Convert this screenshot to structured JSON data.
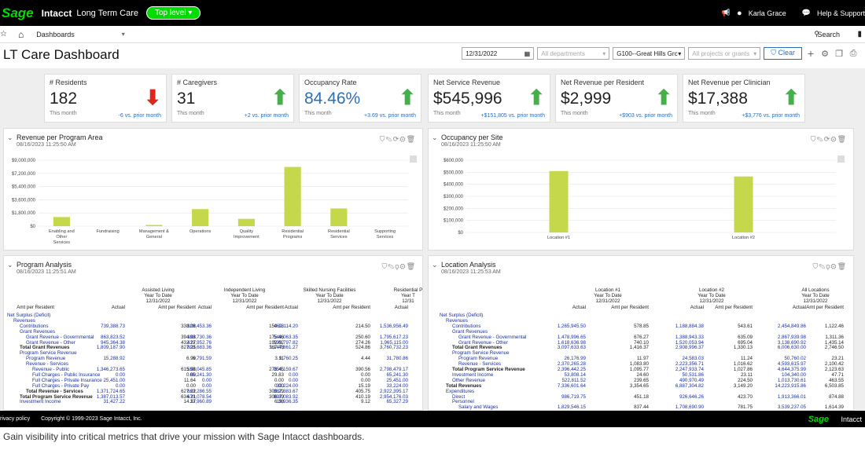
{
  "topbar": {
    "logo": "Sage",
    "product": "Intacct",
    "company": "Long Term Care",
    "level": "Top level",
    "user": "Karla Grace",
    "help": "Help & Support"
  },
  "nav": {
    "menu": "Dashboards",
    "search": "Search"
  },
  "page": {
    "title": "LT Care Dashboard",
    "date": "12/31/2022",
    "departments_ph": "All departments",
    "location": "G100--Great Hills Grc",
    "projects_ph": "All projects or grants",
    "clear": "Clear"
  },
  "kpis": [
    {
      "label": "# Residents",
      "value": "182",
      "sub": "This month",
      "compare": "-6 vs. prior month",
      "trend": "down"
    },
    {
      "label": "# Caregivers",
      "value": "31",
      "sub": "This month",
      "compare": "+2 vs. prior month",
      "trend": "up"
    },
    {
      "label": "Occupancy Rate",
      "value": "84.46%",
      "sub": "This month",
      "compare": "+3.69 vs. prior month",
      "trend": "up"
    },
    {
      "label": "Net Service Revenue",
      "value": "$545,996",
      "sub": "This month",
      "compare": "+$151,805 vs. prior month",
      "trend": "up"
    },
    {
      "label": "Net Revenue per Resident",
      "value": "$2,999",
      "sub": "This month",
      "compare": "+$903 vs. prior month",
      "trend": "up"
    },
    {
      "label": "Net Revenue per Clinician",
      "value": "$17,388",
      "sub": "This month",
      "compare": "+$3,776 vs. prior month",
      "trend": "up"
    }
  ],
  "colors": {
    "up": "#43b048",
    "down": "#e0251b",
    "bar": "#c5d84c",
    "brand": "#00dc00",
    "link": "#2a6ebb"
  },
  "panels": {
    "rev": {
      "title": "Revenue per Program Area",
      "date": "08/16/2023 11:25:50 AM"
    },
    "occ": {
      "title": "Occupancy per Site",
      "date": "08/16/2023 11:25:50 AM"
    },
    "prog": {
      "title": "Program Analysis",
      "date": "08/16/2023 11:25:51 AM"
    },
    "loc": {
      "title": "Location Analysis",
      "date": "08/16/2023 11:25:53 AM"
    }
  },
  "chart_data": [
    {
      "type": "bar",
      "title": "Revenue per Program Area",
      "categories": [
        "Enabling and Other Services",
        "Fundraising",
        "Management & General",
        "Operations",
        "Quality Improvement",
        "Residential Programs",
        "Residential Services",
        "Supporting Services"
      ],
      "values": [
        1500000,
        0,
        200000,
        2800000,
        1200000,
        9700000,
        2900000,
        0
      ],
      "yticks": [
        "$0",
        "$1,800,000",
        "$3,600,000",
        "$5,400,000",
        "$7,200,000",
        "$9,000,000"
      ],
      "ylim": [
        0,
        10800000
      ]
    },
    {
      "type": "bar",
      "title": "Occupancy per Site",
      "categories": [
        "Location #1",
        "Location #2"
      ],
      "values": [
        510000,
        465000
      ],
      "yticks": [
        "$0",
        "$100,000",
        "$200,000",
        "$300,000",
        "$400,000",
        "$500,000",
        "$600,000"
      ],
      "ylim": [
        0,
        600000
      ]
    }
  ],
  "prog": {
    "headers": [
      [
        "Assisted Living",
        "Year To Date",
        "12/31/2022"
      ],
      [
        "Independent Living",
        "Year To Date",
        "12/31/2022"
      ],
      [
        "Skilled Nursing Facilities",
        "Year To Date",
        "12/31/2022"
      ],
      [
        "Residential P",
        "Year T",
        "12/31"
      ]
    ],
    "sub": [
      "Actual",
      "Amt per Resident"
    ],
    "rows": [
      {
        "label": "Net Surplus (Deficit)",
        "ind": 0,
        "cls": "lk",
        "vals": []
      },
      {
        "label": "Revenues",
        "ind": 1,
        "cls": "lk",
        "vals": []
      },
      {
        "label": "Contributions",
        "ind": 2,
        "cls": "lk",
        "vals": [
          "739,388.73",
          "338.08",
          "328,453.36",
          "150.18",
          "469,114.20",
          "214.50",
          "1,536,956.49"
        ]
      },
      {
        "label": "Grant Revenues",
        "ind": 2,
        "cls": "lk",
        "vals": []
      },
      {
        "label": "Grant Revenue - Governmental",
        "ind": 3,
        "cls": "lk",
        "vals": [
          "863,823.52",
          "394.98",
          "383,730.36",
          "175.46",
          "549,063.35",
          "250.60",
          "1,795,617.23"
        ]
      },
      {
        "label": "Grant Revenue - Other",
        "ind": 3,
        "cls": "lk",
        "vals": [
          "945,364.38",
          "432.27",
          "419,952.76",
          "192.02",
          "599,797.82",
          "274.26",
          "1,965,115.00"
        ]
      },
      {
        "label": "Total Grant Revenues",
        "ind": 2,
        "cls": "bold",
        "vals": [
          "1,809,187.90",
          "827.25",
          "803,683.36",
          "367.48",
          "1,147,861.27",
          "524.86",
          "3,760,732.23"
        ]
      },
      {
        "label": "Program Service Revenue",
        "ind": 2,
        "cls": "lk",
        "vals": []
      },
      {
        "label": "Program Revenue",
        "ind": 3,
        "cls": "lk",
        "vals": [
          "15,288.92",
          "6.99",
          "6,791.59",
          "3.11",
          "9,760.25",
          "4.44",
          "31,780.86"
        ]
      },
      {
        "label": "Revenue - Services",
        "ind": 3,
        "cls": "lk",
        "vals": []
      },
      {
        "label": "Revenue - Public",
        "ind": 4,
        "cls": "lk",
        "vals": [
          "1,346,273.65",
          "615.58",
          "598,045.85",
          "273.45",
          "854,159.67",
          "390.56",
          "2,798,479.17"
        ]
      },
      {
        "label": "Full Charges - Public Insurance",
        "ind": 4,
        "cls": "lk",
        "vals": [
          "0.00",
          "0.00",
          "65,241.30",
          "29.83",
          "0.00",
          "0.00",
          "65,241.30"
        ]
      },
      {
        "label": "Full Charges - Private Insurance",
        "ind": 4,
        "cls": "lk",
        "vals": [
          "25,451.00",
          "11.64",
          "0.00",
          "0.00",
          "0.00",
          "0.00",
          "25,451.00"
        ]
      },
      {
        "label": "Full Charges - Private Pay",
        "ind": 4,
        "cls": "lk",
        "vals": [
          "0.00",
          "0.00",
          "0.00",
          "0.00",
          "33,224.00",
          "15.19",
          "33,224.00"
        ]
      },
      {
        "label": "Total Revenue - Services",
        "ind": 3,
        "cls": "bold",
        "vals": [
          "1,371,724.65",
          "627.22",
          "663,286.55",
          "303.29",
          "887,383.67",
          "405.75",
          "2,922,395.17"
        ]
      },
      {
        "label": "Total Program Service Revenue",
        "ind": 2,
        "cls": "bold",
        "vals": [
          "1,387,013.57",
          "634.21",
          "670,078.54",
          "306.39",
          "897,083.92",
          "410.19",
          "2,954,176.03"
        ]
      },
      {
        "label": "Investment Income",
        "ind": 2,
        "cls": "lk",
        "vals": [
          "31,427.22",
          "14.37",
          "13,960.89",
          "6.38",
          "19,936.35",
          "9.12",
          "65,327.29"
        ]
      }
    ]
  },
  "loc": {
    "headers": [
      [
        "Location #1",
        "Year To Date",
        "12/31/2022"
      ],
      [
        "Location #2",
        "Year To Date",
        "12/31/2022"
      ],
      [
        "All Locations",
        "Year To Date",
        "12/31/2022"
      ]
    ],
    "sub": [
      "Actual",
      "Amt per Resident"
    ],
    "rows": [
      {
        "label": "Net Surplus (Deficit)",
        "ind": 0,
        "cls": "lk",
        "vals": []
      },
      {
        "label": "Revenues",
        "ind": 1,
        "cls": "lk",
        "vals": []
      },
      {
        "label": "Contributions",
        "ind": 2,
        "cls": "lk",
        "vals": [
          "1,265,945.50",
          "578.85",
          "1,188,884.38",
          "543.61",
          "2,454,849.86",
          "1,122.46"
        ]
      },
      {
        "label": "Grant Revenues",
        "ind": 2,
        "cls": "lk",
        "vals": []
      },
      {
        "label": "Grant Revenue - Governmental",
        "ind": 3,
        "cls": "lk",
        "vals": [
          "1,478,996.65",
          "676.27",
          "1,388,943.33",
          "635.09",
          "2,867,939.98",
          "1,311.36"
        ]
      },
      {
        "label": "Grant Revenue - Other",
        "ind": 3,
        "cls": "lk",
        "vals": [
          "1,618,636.98",
          "740.10",
          "1,520,053.94",
          "695.04",
          "3,138,690.92",
          "1,435.14"
        ]
      },
      {
        "label": "Total Grant Revenues",
        "ind": 2,
        "cls": "bold",
        "vals": [
          "3,097,633.63",
          "1,416.37",
          "2,908,996.37",
          "1,330.13",
          "6,006,630.00",
          "2,746.50"
        ]
      },
      {
        "label": "Program Service Revenue",
        "ind": 2,
        "cls": "lk",
        "vals": []
      },
      {
        "label": "Program Revenue",
        "ind": 3,
        "cls": "lk",
        "vals": [
          "26,176.99",
          "11.97",
          "24,583.03",
          "11.24",
          "50,760.02",
          "23.21"
        ]
      },
      {
        "label": "Revenue - Services",
        "ind": 3,
        "cls": "lk",
        "vals": [
          "2,370,265.28",
          "1,083.80",
          "2,223,356.71",
          "1,016.62",
          "4,593,615.97",
          "2,100.42"
        ]
      },
      {
        "label": "Total Program Service Revenue",
        "ind": 2,
        "cls": "bold",
        "vals": [
          "2,396,442.25",
          "1,095.77",
          "2,247,933.74",
          "1,027.86",
          "4,644,375.99",
          "2,123.63"
        ]
      },
      {
        "label": "Investment Income",
        "ind": 2,
        "cls": "lk",
        "vals": [
          "53,808.14",
          "24.60",
          "50,531.86",
          "23.11",
          "104,340.00",
          "47.71"
        ]
      },
      {
        "label": "Other Revenue",
        "ind": 2,
        "cls": "lk",
        "vals": [
          "522,811.52",
          "239.65",
          "490,970.49",
          "224.50",
          "1,013,730.61",
          "463.55"
        ]
      },
      {
        "label": "Total Revenues",
        "ind": 1,
        "cls": "bold",
        "vals": [
          "7,336,601.64",
          "3,354.65",
          "6,887,304.82",
          "3,149.20",
          "14,223,915.86",
          "6,503.85"
        ]
      },
      {
        "label": "Expenditures",
        "ind": 1,
        "cls": "lk",
        "vals": []
      },
      {
        "label": "Direct",
        "ind": 2,
        "cls": "lk",
        "vals": [
          "986,719.75",
          "451.18",
          "926,646.26",
          "423.70",
          "1,913,366.01",
          "874.88"
        ]
      },
      {
        "label": "Personnel",
        "ind": 2,
        "cls": "lk",
        "vals": []
      },
      {
        "label": "Salary and Wages",
        "ind": 3,
        "cls": "lk",
        "vals": [
          "1,829,546.15",
          "837.44",
          "1,708,690.90",
          "781.75",
          "3,539,237.05",
          "1,614.39"
        ]
      }
    ]
  },
  "footer": {
    "privacy": "rivacy policy",
    "copyright": "Copyright © 1999-2023 Sage Intacct, Inc.",
    "logo": "Sage",
    "product": "Intacct"
  },
  "caption": "Gain visibility into critical metrics that drive your mission with Sage Intacct dashboards."
}
